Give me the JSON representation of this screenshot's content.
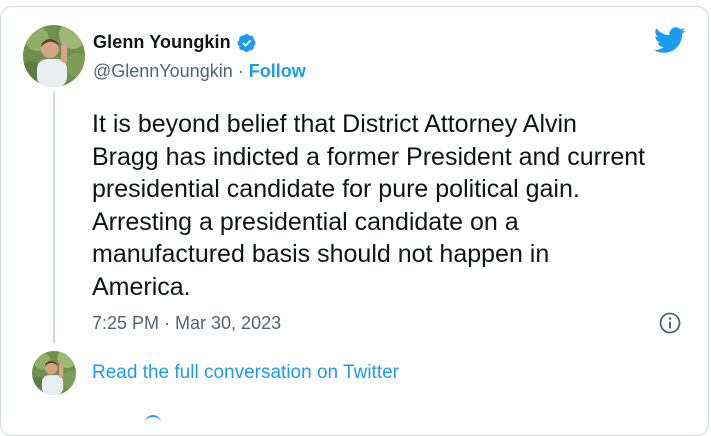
{
  "author": {
    "display_name": "Glenn Youngkin",
    "handle": "@GlennYoungkin",
    "separator": "·",
    "follow_label": "Follow",
    "verified": true
  },
  "tweet": {
    "text_lines": [
      "It is beyond belief that District Attorney Alvin",
      "Bragg has indicted a former President and current",
      "presidential candidate for pure political gain.",
      "Arresting a presidential candidate on a",
      "manufactured basis should not happen in",
      "America."
    ],
    "timestamp": "7:25 PM · Mar 30, 2023"
  },
  "footer": {
    "read_link": "Read the full conversation on Twitter"
  },
  "icons": {
    "brand": "twitter-bird-icon",
    "verified": "verified-badge-icon",
    "info": "info-icon"
  },
  "colors": {
    "brand_blue": "#1d9bf0",
    "text": "#0f1419",
    "secondary_text": "#536471",
    "border": "#cfd9de"
  }
}
